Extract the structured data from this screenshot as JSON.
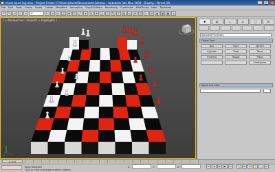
{
  "window": {
    "title": "chess laura leg.max - Project Folder: C:\\Users\\stuart\\Documents\\3dsmax - Autodesk 3ds Max 2009 - Display : Direct 3D",
    "min": "_",
    "max": "□",
    "close": "✕"
  },
  "menu": [
    "File",
    "Edit",
    "Tools",
    "Group",
    "Views",
    "Create",
    "Modifiers",
    "Animation",
    "Graph Editors",
    "Rendering",
    "Customize",
    "MAXScript",
    "Help",
    "Tentacles"
  ],
  "toolbar": {
    "selection_filter": "All"
  },
  "viewport": {
    "label": "[ + Perspective | Smooth + Highlights ]"
  },
  "command_panel": {
    "category": "Standard Primitives",
    "rollout_object_type": "Object Type",
    "primitives": [
      "Box",
      "Cone",
      "Sphere",
      "Cylinder",
      "Tube",
      "Torus",
      "Pyramid",
      "Teapot",
      "Plane",
      "",
      "",
      "GeoSphere"
    ],
    "rollout_name_color": "Name and Color"
  },
  "timeline": {
    "frame": "0 / 100"
  },
  "status": {
    "selection": "None Selected",
    "prompt": "Click or click-and-drag to select objects",
    "x_label": "X:",
    "y_label": "Y:",
    "z_label": "Z:"
  },
  "colors": {
    "red": "#e0240f",
    "white": "#f4f4f4",
    "black": "#0a0a0a"
  }
}
